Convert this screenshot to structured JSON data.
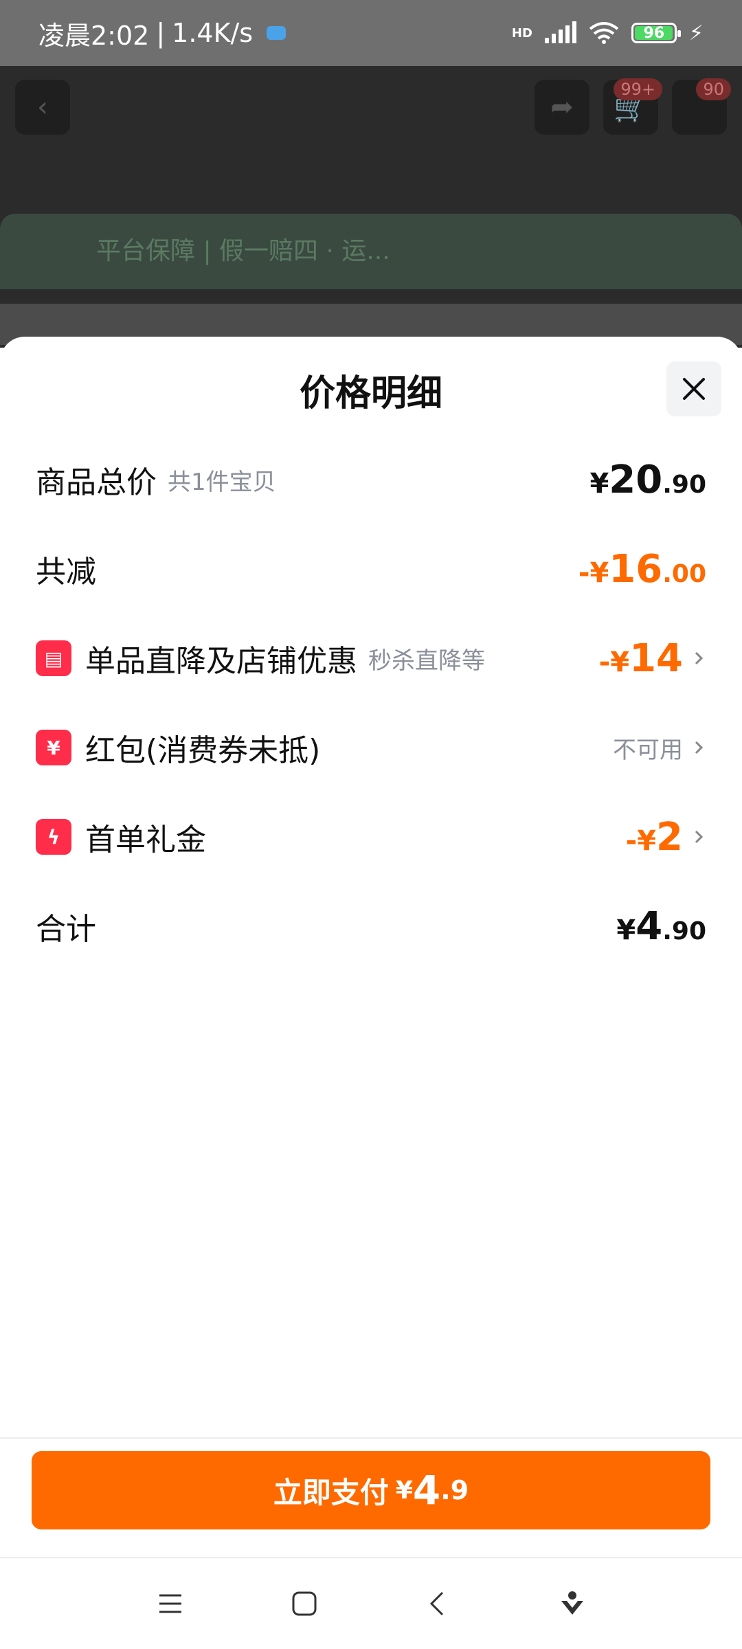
{
  "status_bar": {
    "time": "凌晨2:02",
    "speed": "1.4K/s",
    "battery": "96",
    "network": "HD"
  },
  "background_page": {
    "cart_badge": "99+",
    "badge2": "90",
    "guarantee_text": "平台保障 | 假一赔四 · 运..."
  },
  "sheet": {
    "title": "价格明细",
    "rows": [
      {
        "label": "商品总价",
        "sub": "共1件宝贝",
        "cur": "¥",
        "int": "20",
        "dec": ".90"
      },
      {
        "label": "共减",
        "cur": "-¥",
        "int": "16",
        "dec": ".00"
      },
      {
        "label": "单品直降及店铺优惠",
        "sub": "秒杀直降等",
        "cur": "-¥",
        "int": "14"
      },
      {
        "label": "红包(消费券未抵)",
        "status": "不可用"
      },
      {
        "label": "首单礼金",
        "cur": "-¥",
        "int": "2"
      },
      {
        "label": "合计",
        "cur": "¥",
        "int": "4",
        "dec": ".90"
      }
    ]
  },
  "pay_button": {
    "label": "立即支付",
    "cur": "¥",
    "int": "4",
    "dec": ".9"
  },
  "colors": {
    "accent": "#ff6a00",
    "icon_red": "#ff2d4a"
  }
}
